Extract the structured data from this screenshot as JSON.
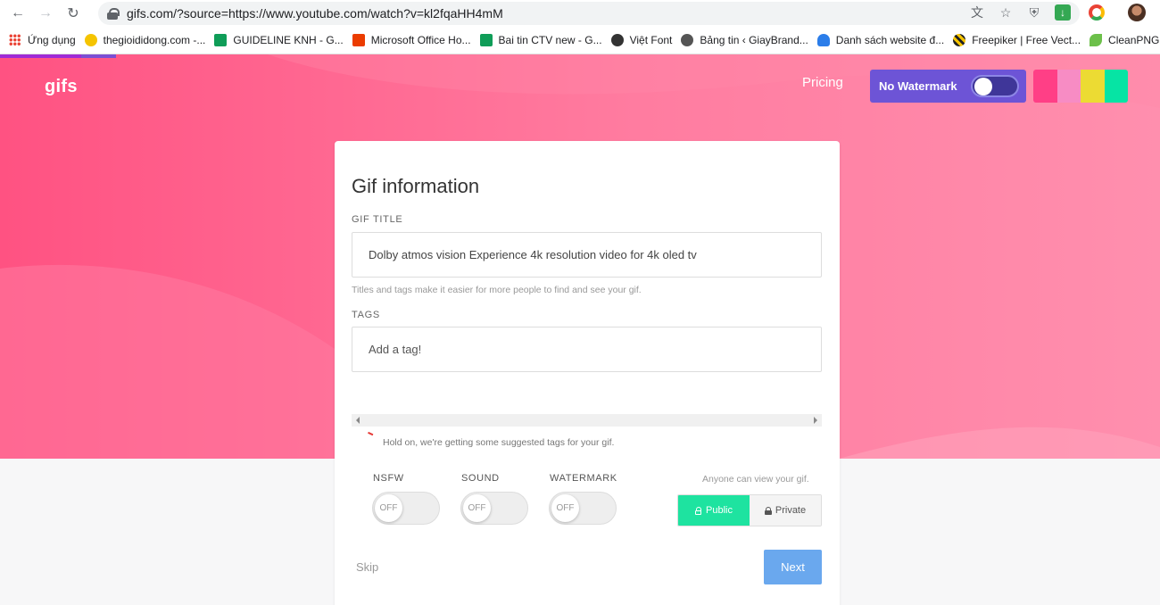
{
  "browser": {
    "url": "gifs.com/?source=https://www.youtube.com/watch?v=kl2fqaHH4mM",
    "bookmarks": [
      {
        "label": "Ứng dụng",
        "icon": "apps-icon"
      },
      {
        "label": "thegioididong.com -...",
        "icon": "tgdd-icon"
      },
      {
        "label": "GUIDELINE KNH - G...",
        "icon": "sheets-icon"
      },
      {
        "label": "Microsoft Office Ho...",
        "icon": "office-icon"
      },
      {
        "label": "Bai tin CTV new - G...",
        "icon": "sheets-icon"
      },
      {
        "label": "Việt Font",
        "icon": "vietfont-icon"
      },
      {
        "label": "Bảng tin ‹ GiayBrand...",
        "icon": "wordpress-icon"
      },
      {
        "label": "Danh sách website đ...",
        "icon": "person-icon"
      },
      {
        "label": "Freepiker | Free Vect...",
        "icon": "freepiker-icon"
      },
      {
        "label": "CleanPNG - HD png...",
        "icon": "cleanpng-icon"
      }
    ]
  },
  "header": {
    "logo": "gifs",
    "pricing": "Pricing",
    "no_watermark": "No Watermark",
    "swatch_colors": [
      "#ff3f86",
      "#f78cc4",
      "#ecdb33",
      "#06e4a4"
    ]
  },
  "form": {
    "title": "Gif information",
    "gif_title_label": "GIF TITLE",
    "gif_title_value": "Dolby atmos vision Experience 4k resolution video for 4k oled tv",
    "hint": "Titles and tags make it easier for more people to find and see your gif.",
    "tags_label": "TAGS",
    "tags_placeholder": "Add a tag!",
    "loading_text": "Hold on, we're getting some suggested tags for your gif.",
    "toggles": [
      {
        "label": "NSFW",
        "state": "OFF"
      },
      {
        "label": "SOUND",
        "state": "OFF"
      },
      {
        "label": "WATERMARK",
        "state": "OFF"
      }
    ],
    "visibility_hint": "Anyone can view your gif.",
    "public_label": "Public",
    "private_label": "Private",
    "skip": "Skip",
    "next": "Next"
  }
}
